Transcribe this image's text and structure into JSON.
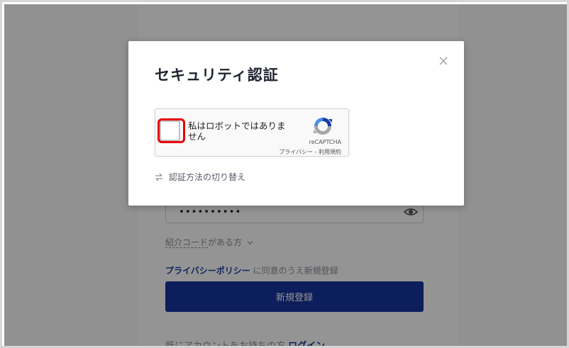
{
  "background_page": {
    "password_masked": "••••••••••",
    "referral_label": "紹介コードがある方",
    "referral_underlined": "紹介コード",
    "referral_suffix": "がある方",
    "policy_link": "プライバシーポリシー",
    "policy_suffix": " に同意のうえ新規登録",
    "signup_button": "新規登録",
    "login_prefix": "既にアカウントをお持ちの方 ",
    "login_link": "ログイン"
  },
  "modal": {
    "title": "セキュリティ認証",
    "close_icon": "close-icon",
    "recaptcha": {
      "label": "私はロボットではありません",
      "brand": "reCAPTCHA",
      "privacy_link": "プライバシー",
      "separator": " - ",
      "terms_link": "利用規約",
      "highlight_color": "#e8000b"
    },
    "switch_method": "認証方法の切り替え"
  },
  "colors": {
    "primary": "#16349e",
    "link": "#1a3fa0"
  }
}
